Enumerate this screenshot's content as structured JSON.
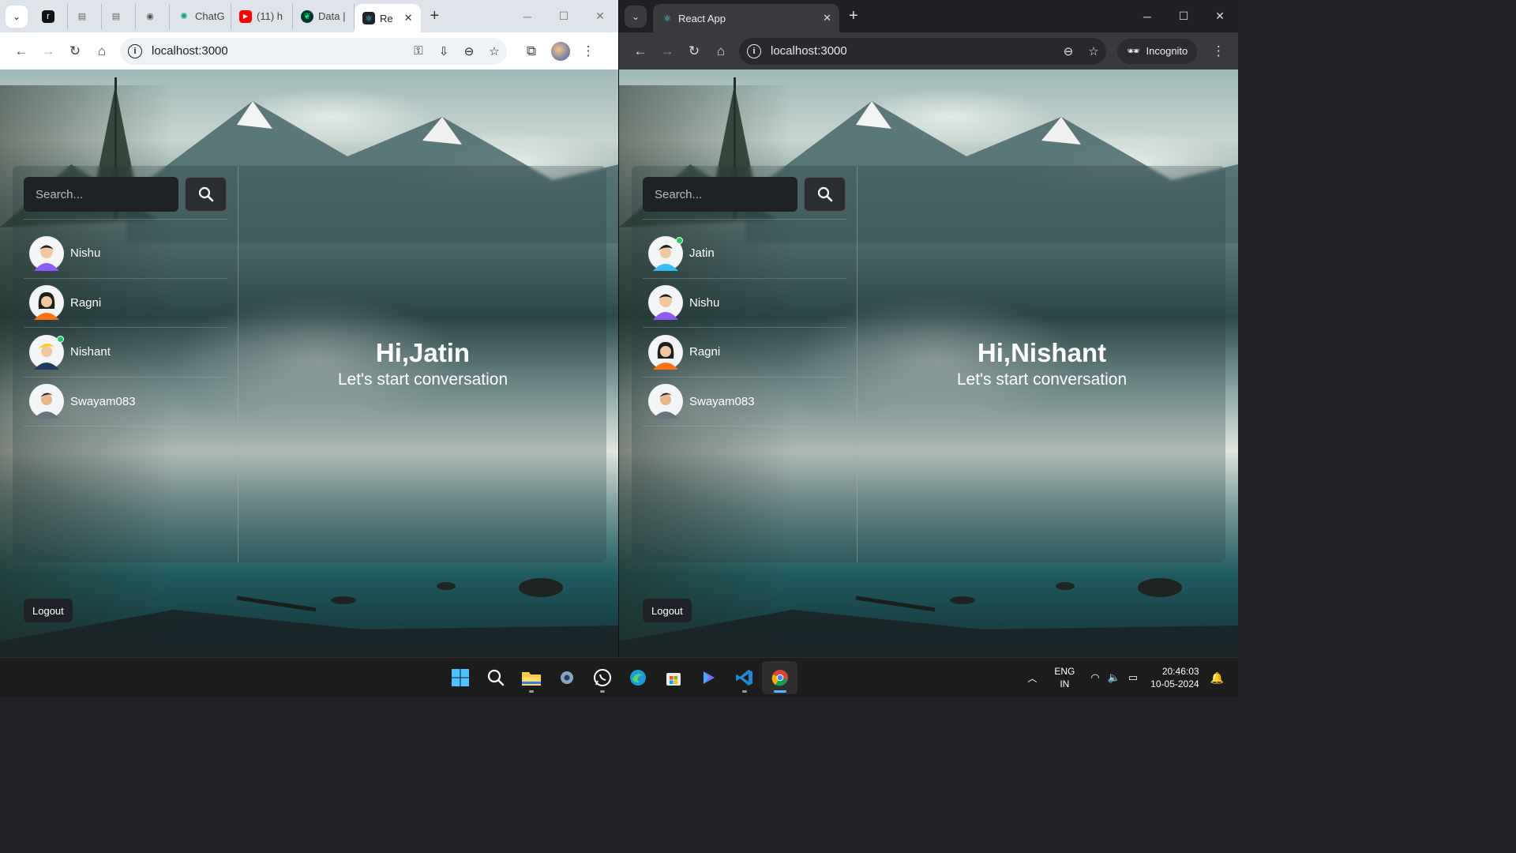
{
  "left_browser": {
    "tabs": [
      {
        "label": "",
        "icon": "r-icon"
      },
      {
        "label": "",
        "icon": "doc-icon"
      },
      {
        "label": "",
        "icon": "doc-icon"
      },
      {
        "label": "",
        "icon": "github-icon"
      },
      {
        "label": "ChatG",
        "icon": "chatgpt-icon"
      },
      {
        "label": "(11) h",
        "icon": "youtube-icon"
      },
      {
        "label": "Data |",
        "icon": "mongodb-icon"
      },
      {
        "label": "Re",
        "icon": "react-icon",
        "active": true
      }
    ],
    "url": "localhost:3000"
  },
  "right_browser": {
    "tab_label": "React App",
    "url": "localhost:3000",
    "incognito_label": "Incognito"
  },
  "left_app": {
    "search_placeholder": "Search...",
    "users": [
      {
        "name": "Nishu",
        "color": "#8b5cf6",
        "online": false
      },
      {
        "name": "Ragni",
        "color": "#f97316",
        "online": false
      },
      {
        "name": "Nishant",
        "color": "#1e3a5f",
        "online": true
      },
      {
        "name": "Swayam083",
        "color": "#6b7280",
        "online": false
      }
    ],
    "greeting": "Hi,Jatin",
    "subtitle": "Let's start conversation",
    "logout_label": "Logout"
  },
  "right_app": {
    "search_placeholder": "Search...",
    "users": [
      {
        "name": "Jatin",
        "color": "#38bdf8",
        "online": true
      },
      {
        "name": "Nishu",
        "color": "#8b5cf6",
        "online": false
      },
      {
        "name": "Ragni",
        "color": "#f97316",
        "online": false
      },
      {
        "name": "Swayam083",
        "color": "#6b7280",
        "online": false
      }
    ],
    "greeting": "Hi,Nishant",
    "subtitle": "Let's start conversation",
    "logout_label": "Logout"
  },
  "taskbar": {
    "apps": [
      "windows-start-icon",
      "search-icon",
      "file-explorer-icon",
      "settings-icon",
      "whatsapp-icon",
      "edge-icon",
      "store-icon",
      "copilot-icon",
      "vscode-icon",
      "chrome-icon"
    ],
    "lang_top": "ENG",
    "lang_bottom": "IN",
    "time": "20:46:03",
    "date": "10-05-2024"
  }
}
